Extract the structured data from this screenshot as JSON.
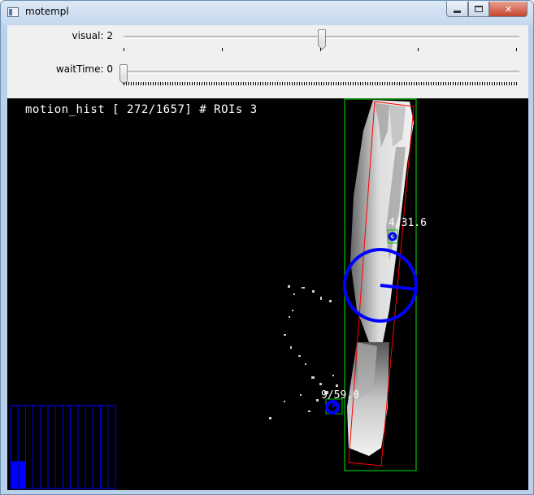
{
  "window": {
    "title": "motempl",
    "minimize_label": "minimize",
    "maximize_label": "maximize",
    "close_label": "close"
  },
  "trackbars": [
    {
      "label": "visual: 2",
      "value": 2,
      "max": 4
    },
    {
      "label": "waitTime: 0",
      "value": 0,
      "max": 200
    }
  ],
  "display": {
    "overlay_text": "motion_hist [ 272/1657] # ROIs 3",
    "frame_current": 272,
    "frame_total": 1657,
    "roi_count": 3,
    "rois": [
      {
        "label": "4/31.6",
        "angle_deg": 31.6
      },
      {
        "label": "9/59.0",
        "angle_deg": 59.0
      }
    ],
    "histogram": {
      "bins": 14,
      "filled_bins": [
        {
          "bin": 0,
          "fraction": 0.33
        },
        {
          "bin": 1,
          "fraction": 0.33
        }
      ]
    },
    "colors": {
      "motion_blue": "#0000ff",
      "roi_box_green": "#00c000",
      "contour_red": "#ff0000",
      "background": "#000000"
    }
  }
}
